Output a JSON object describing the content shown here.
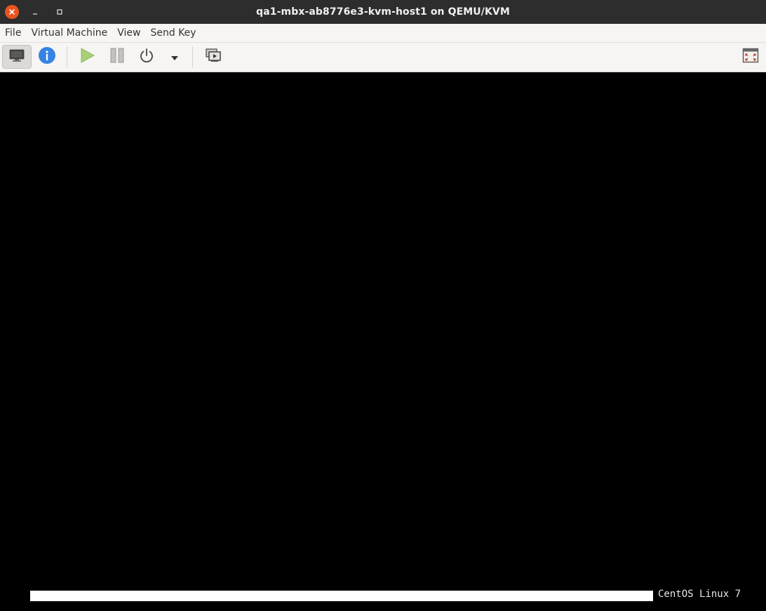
{
  "window": {
    "title": "qa1-mbx-ab8776e3-kvm-host1 on QEMU/KVM",
    "controls": [
      "close-icon",
      "minimize-icon",
      "maximize-icon"
    ]
  },
  "menubar": {
    "items": [
      "File",
      "Virtual Machine",
      "View",
      "Send Key"
    ]
  },
  "toolbar": {
    "buttons": [
      {
        "name": "console-view",
        "icon": "monitor-icon",
        "active": true
      },
      {
        "name": "details-view",
        "icon": "info-icon",
        "active": false
      },
      {
        "name": "run",
        "icon": "play-icon",
        "active": false
      },
      {
        "name": "pause",
        "icon": "pause-icon",
        "active": false
      },
      {
        "name": "shutdown",
        "icon": "power-icon",
        "active": false
      },
      {
        "name": "shutdown-menu",
        "icon": "chevron-down-icon",
        "active": false
      },
      {
        "name": "snapshots",
        "icon": "snapshot-icon",
        "active": false
      },
      {
        "name": "fullscreen",
        "icon": "fullscreen-icon",
        "active": false
      }
    ]
  },
  "console": {
    "boot_label": "CentOS Linux 7",
    "boot_progress": 1.0
  },
  "colors": {
    "titlebar": "#2d2d2d",
    "close_button": "#e95420",
    "info_blue": "#3584e4",
    "play_green": "#9bc464",
    "console_bg": "#000000"
  }
}
